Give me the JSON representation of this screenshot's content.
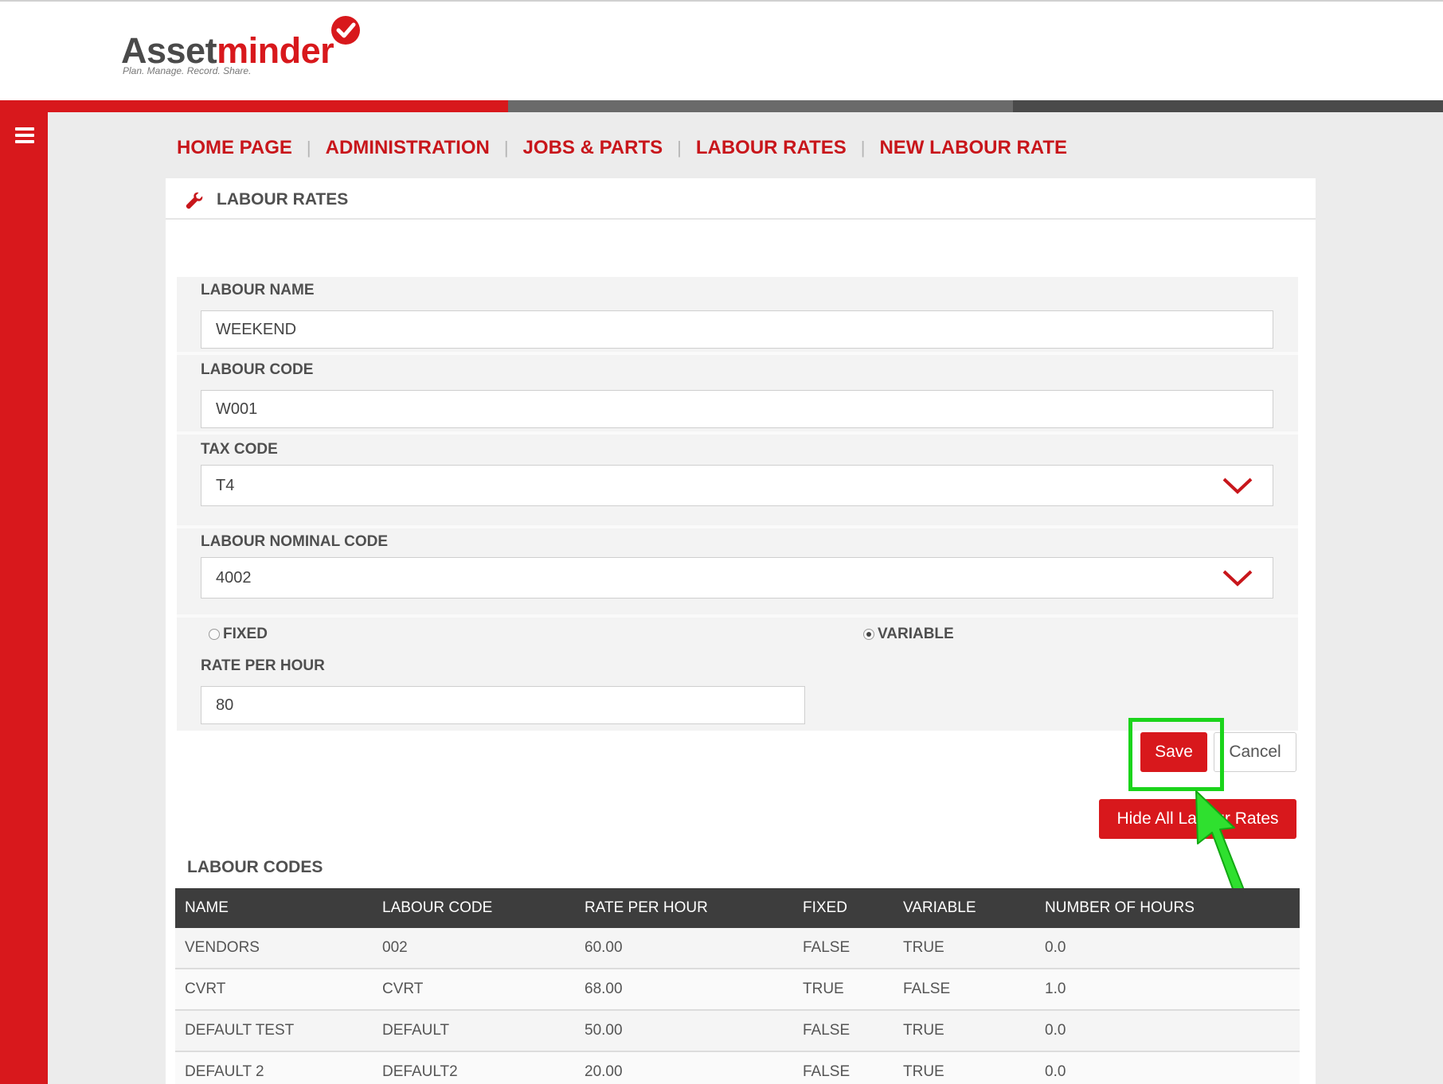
{
  "brand": {
    "name_part1": "Asset",
    "name_part2": "minder",
    "tagline": "Plan. Manage. Record. Share.",
    "accent_color": "#d8181c"
  },
  "breadcrumb": [
    {
      "label": "HOME PAGE"
    },
    {
      "label": "ADMINISTRATION"
    },
    {
      "label": "JOBS & PARTS"
    },
    {
      "label": "LABOUR RATES"
    },
    {
      "label": "NEW LABOUR RATE"
    }
  ],
  "breadcrumb_separator": "|",
  "card": {
    "title": "LABOUR RATES",
    "icon": "wrench-icon"
  },
  "form": {
    "labour_name": {
      "label": "LABOUR NAME",
      "value": "WEEKEND"
    },
    "labour_code": {
      "label": "LABOUR CODE",
      "value": "W001"
    },
    "tax_code": {
      "label": "TAX CODE",
      "value": "T4"
    },
    "labour_nominal_code": {
      "label": "LABOUR NOMINAL CODE",
      "value": "4002"
    },
    "rate_type": {
      "fixed_label": "FIXED",
      "variable_label": "VARIABLE",
      "selected": "VARIABLE"
    },
    "rate_per_hour": {
      "label": "RATE PER HOUR",
      "value": "80"
    }
  },
  "buttons": {
    "save": "Save",
    "cancel": "Cancel",
    "hide_all": "Hide All Labour Rates"
  },
  "annotation": {
    "highlight_color": "#1bd41b",
    "highlight_target": "save-button"
  },
  "labour_codes": {
    "title": "LABOUR CODES",
    "columns": [
      "NAME",
      "LABOUR CODE",
      "RATE PER HOUR",
      "FIXED",
      "VARIABLE",
      "NUMBER OF HOURS"
    ],
    "rows": [
      [
        "VENDORS",
        "002",
        "60.00",
        "FALSE",
        "TRUE",
        "0.0"
      ],
      [
        "CVRT",
        "CVRT",
        "68.00",
        "TRUE",
        "FALSE",
        "1.0"
      ],
      [
        "DEFAULT TEST",
        "DEFAULT",
        "50.00",
        "FALSE",
        "TRUE",
        "0.0"
      ],
      [
        "DEFAULT 2",
        "DEFAULT2",
        "20.00",
        "FALSE",
        "TRUE",
        "0.0"
      ]
    ]
  }
}
